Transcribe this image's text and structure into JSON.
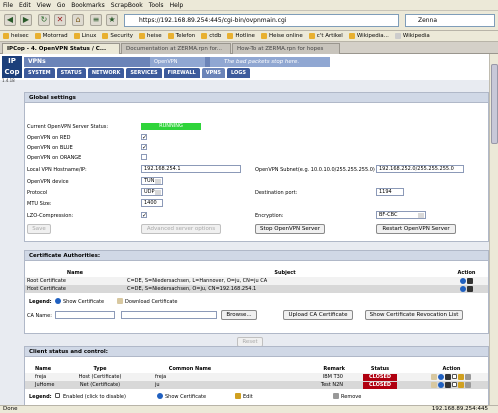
{
  "menubar": [
    "File",
    "Edit",
    "View",
    "Go",
    "Bookmarks",
    "ScrapBook",
    "Tools",
    "Help"
  ],
  "navbar": {
    "url": "https://192.168.89.254:445/cgi-bin/ovpnmain.cgi",
    "search_value": "Zenna"
  },
  "bookmarks": [
    "heisec",
    "Motorrad",
    "Linux",
    "Security",
    "heise",
    "Telefon",
    "ctdb",
    "Hotline",
    "Heise online",
    "c't Artikel",
    "Wikipedia...",
    "Wikipedia"
  ],
  "tabs": [
    "IPCop - 4. OpenVPN Status / C...",
    "Documentation at ZERMA.rpn for...",
    "How-To at ZERMA.rpn for hopes"
  ],
  "banner": {
    "logo": "IP\nCop",
    "version": "1.4.18",
    "section_title": "VPNs",
    "sub_title": "OpenVPN",
    "slogan": "The bad packets stop here.",
    "nav": [
      "SYSTEM",
      "STATUS",
      "NETWORK",
      "SERVICES",
      "FIREWALL",
      "VPNS",
      "LOGS"
    ]
  },
  "global": {
    "heading": "Global settings",
    "status_label": "Current OpenVPN Server Status:",
    "status_value": "RUNNING",
    "on_red_label": "OpenVPN on RED",
    "on_blue_label": "OpenVPN on BLUE",
    "on_orange_label": "OpenVPN on ORANGE",
    "hostname_label": "Local VPN Hostname/IP:",
    "hostname_value": "192.168.254.1",
    "subnet_label": "OpenVPN Subnet(e.g. 10.0.10.0/255.255.255.0)",
    "subnet_value": "192.168.252.0/255.255.255.0",
    "device_label": "OpenVPN device",
    "device_value": "TUN",
    "protocol_label": "Protocol",
    "protocol_value": "UDP",
    "dest_port_label": "Destination port:",
    "dest_port_value": "1194",
    "mtu_label": "MTU Size:",
    "mtu_value": "1400",
    "lzo_label": "LZO-Compression:",
    "encryption_label": "Encryption:",
    "encryption_value": "BF-CBC",
    "save_btn": "Save",
    "advanced_btn": "Advanced server options",
    "stop_btn": "Stop OpenVPN Server",
    "restart_btn": "Restart OpenVPN Server"
  },
  "ca": {
    "heading": "Certificate Authorities:",
    "col_name": "Name",
    "col_subject": "Subject",
    "col_action": "Action",
    "rows": [
      {
        "name": "Root Certificate",
        "subject": "C=DE, S=Niedersachsen, L=Hannover, O=ju, CN=ju CA"
      },
      {
        "name": "Host Certificate",
        "subject": "C=DE, S=Niedersachsen, O=ju, CN=192.168.254.1"
      }
    ],
    "legend_label": "Legend:",
    "legend_show": "Show Certificate",
    "legend_download": "Download Certificate",
    "ca_name_label": "CA Name:",
    "browse_btn": "Browse...",
    "upload_btn": "Upload CA Certificate",
    "revocation_btn": "Show Certificate Revocation List",
    "reset_btn": "Reset"
  },
  "clients": {
    "heading": "Client status and control:",
    "col_name": "Name",
    "col_type": "Type",
    "col_common": "Common Name",
    "col_remark": "Remark",
    "col_status": "Status",
    "col_action": "Action",
    "rows": [
      {
        "name": "freja",
        "type": "Host (Certificate)",
        "common": "freja",
        "remark": "IBM T30",
        "status": "CLOSED"
      },
      {
        "name": "JuHome",
        "type": "Net (Certificate)",
        "common": "ju",
        "remark": "Test N2N",
        "status": "CLOSED"
      }
    ],
    "legend_label": "Legend:",
    "legend_enabled": "Enabled (click to disable)",
    "legend_show": "Show Certificate",
    "legend_edit": "Edit",
    "legend_remove": "Remove"
  },
  "statusbar": {
    "text": "Done",
    "url": "192.168.89.254:445"
  },
  "colors": {
    "running": "#2fd43a",
    "closed": "#b00010",
    "nav": "#3d5b9c"
  }
}
